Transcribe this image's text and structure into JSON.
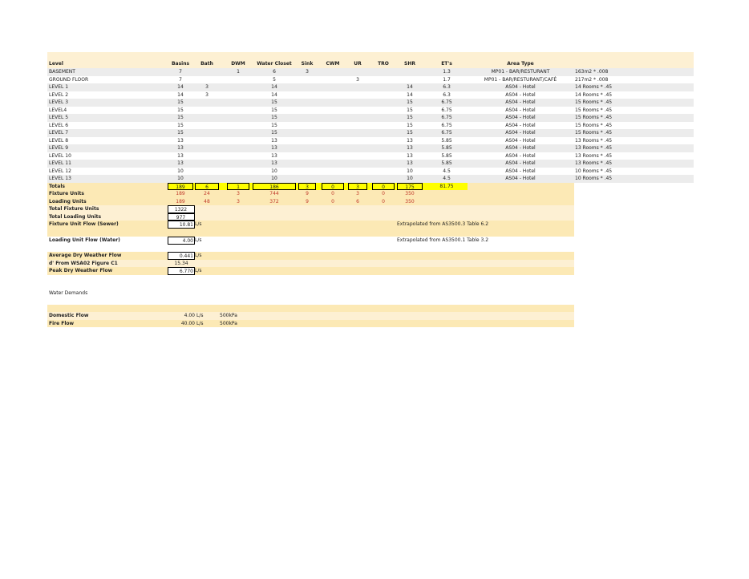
{
  "table": {
    "headers": [
      "Level",
      "Basins",
      "Bath",
      "DWM",
      "Water Closet",
      "Sink",
      "CWM",
      "UR",
      "TRO",
      "SHR",
      "ET's",
      "Area Type"
    ],
    "rows": [
      [
        "BASEMENT",
        "7",
        "",
        "1",
        "6",
        "3",
        "",
        "",
        "",
        "",
        "1.3",
        "MP01 - BAR/RESTURANT",
        "163m2 * .008"
      ],
      [
        "GROUND FLOOR",
        "7",
        "",
        "",
        "5",
        "",
        "",
        "3",
        "",
        "",
        "1.7",
        "MP01 - BAR/RESTURANT/CAFÉ",
        "217m2 * .008"
      ],
      [
        "LEVEL 1",
        "14",
        "3",
        "",
        "14",
        "",
        "",
        "",
        "",
        "14",
        "6.3",
        "AS04 - Hotel",
        "14 Rooms * .45"
      ],
      [
        "LEVEL 2",
        "14",
        "3",
        "",
        "14",
        "",
        "",
        "",
        "",
        "14",
        "6.3",
        "AS04 - Hotel",
        "14 Rooms * .45"
      ],
      [
        "LEVEL 3",
        "15",
        "",
        "",
        "15",
        "",
        "",
        "",
        "",
        "15",
        "6.75",
        "AS04 - Hotel",
        "15 Rooms * .45"
      ],
      [
        "LEVEL4",
        "15",
        "",
        "",
        "15",
        "",
        "",
        "",
        "",
        "15",
        "6.75",
        "AS04 - Hotel",
        "15 Rooms * .45"
      ],
      [
        "LEVEL 5",
        "15",
        "",
        "",
        "15",
        "",
        "",
        "",
        "",
        "15",
        "6.75",
        "AS04 - Hotel",
        "15 Rooms * .45"
      ],
      [
        "LEVEL 6",
        "15",
        "",
        "",
        "15",
        "",
        "",
        "",
        "",
        "15",
        "6.75",
        "AS04 - Hotel",
        "15 Rooms * .45"
      ],
      [
        "LEVEL 7",
        "15",
        "",
        "",
        "15",
        "",
        "",
        "",
        "",
        "15",
        "6.75",
        "AS04 - Hotel",
        "15 Rooms * .45"
      ],
      [
        "LEVEL 8",
        "13",
        "",
        "",
        "13",
        "",
        "",
        "",
        "",
        "13",
        "5.85",
        "AS04 - Hotel",
        "13 Rooms * .45"
      ],
      [
        "LEVEL 9",
        "13",
        "",
        "",
        "13",
        "",
        "",
        "",
        "",
        "13",
        "5.85",
        "AS04 - Hotel",
        "13 Rooms * .45"
      ],
      [
        "LEVEL 10",
        "13",
        "",
        "",
        "13",
        "",
        "",
        "",
        "",
        "13",
        "5.85",
        "AS04 - Hotel",
        "13 Rooms * .45"
      ],
      [
        "LEVEL 11",
        "13",
        "",
        "",
        "13",
        "",
        "",
        "",
        "",
        "13",
        "5.85",
        "AS04 - Hotel",
        "13 Rooms * .45"
      ],
      [
        "LEVEL 12",
        "10",
        "",
        "",
        "10",
        "",
        "",
        "",
        "",
        "10",
        "4.5",
        "AS04 - Hotel",
        "10 Rooms * .45"
      ],
      [
        "LEVEL 13",
        "10",
        "",
        "",
        "10",
        "",
        "",
        "",
        "",
        "10",
        "4.5",
        "AS04 - Hotel",
        "10 Rooms * .45"
      ]
    ],
    "totals": [
      "Totals",
      "189",
      "6",
      "1",
      "186",
      "3",
      "0",
      "3",
      "0",
      "175",
      "81.75"
    ],
    "fixture_units": [
      "Fixture Units",
      "189",
      "24",
      "3",
      "744",
      "9",
      "0",
      "3",
      "0",
      "350"
    ],
    "loading_units": [
      "Loading Units",
      "189",
      "48",
      "3",
      "372",
      "9",
      "0",
      "6",
      "0",
      "350"
    ]
  },
  "summary": {
    "total_fixture_label": "Total Fixture Units",
    "total_fixture_value": "1322",
    "total_loading_label": "Total Loading Units",
    "total_loading_value": "977",
    "fixture_flow_label": "Fixture Unit Flow (Sewer)",
    "fixture_flow_value": "10.81",
    "fixture_flow_unit": "L/s",
    "fixture_flow_note": "Extrapolated from AS3500.3 Table 6.2",
    "loading_flow_label": "Loading Unit Flow (Water)",
    "loading_flow_value": "4.00",
    "loading_flow_unit": "L/s",
    "loading_flow_note": "Extrapolated from AS3500.1 Table 3.2",
    "adwf_label": "Average Dry Weather Flow",
    "adwf_value": "0.441",
    "adwf_unit": "L/s",
    "d_label": "d' From WSA02 Figure C1",
    "d_value": "15.34",
    "pdwf_label": "Peak Dry Weather Flow",
    "pdwf_value": "6.770",
    "pdwf_unit": "L/s"
  },
  "demands": {
    "title": "Water Demands",
    "domestic_label": "Domestic Flow",
    "domestic_value": "4.00",
    "domestic_unit": "L/s",
    "domestic_pressure": "500kPa",
    "fire_label": "Fire Flow",
    "fire_value": "40.00",
    "fire_unit": "L/s",
    "fire_pressure": "500kPa"
  },
  "colors": {
    "header": "#fdf0d3",
    "tan": "#fce9b5",
    "totals": "#ffff00",
    "red": "#c0392b"
  }
}
